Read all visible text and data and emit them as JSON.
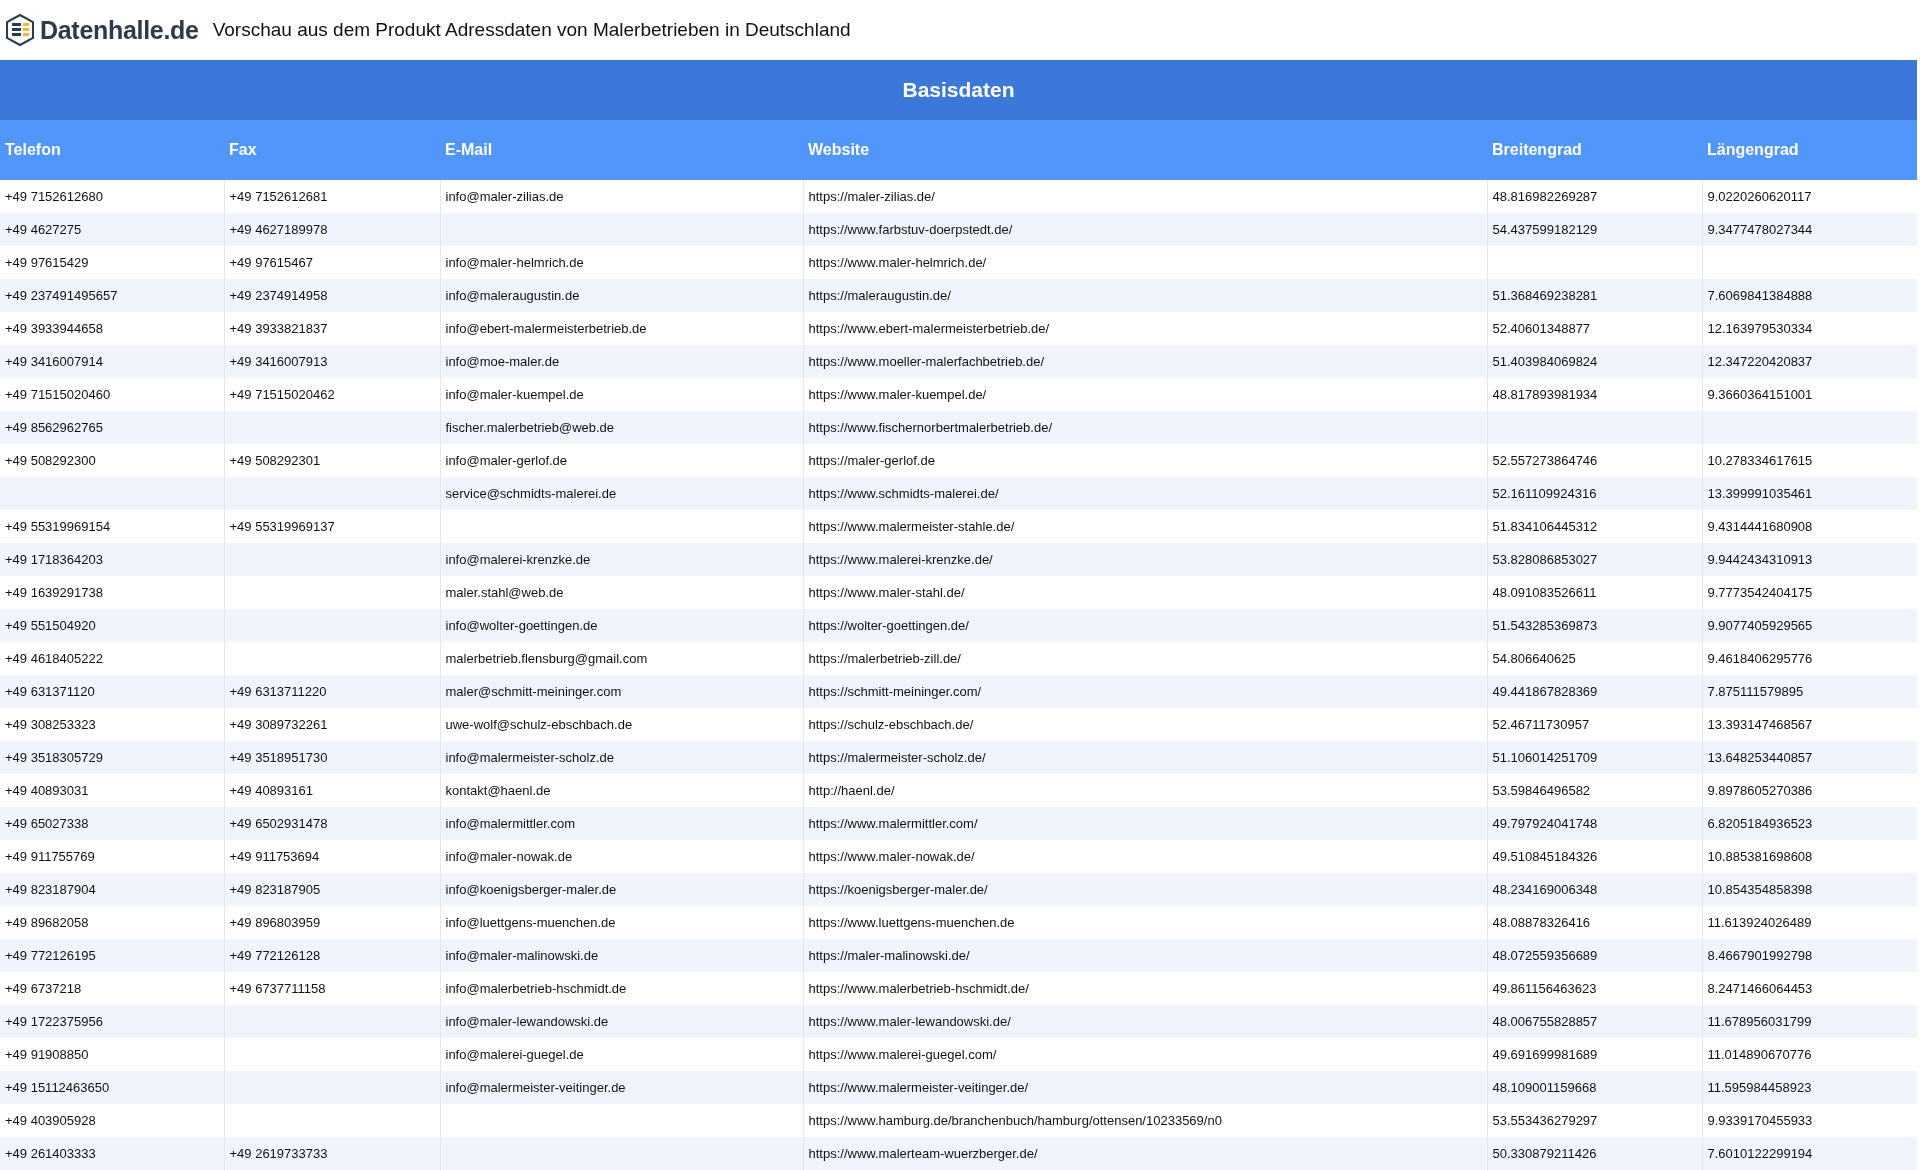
{
  "header": {
    "logo_text": "Datenhalle.de",
    "title": "Vorschau aus dem Produkt Adressdaten von Malerbetrieben in Deutschland"
  },
  "table": {
    "group_heading": "Basisdaten",
    "columns": [
      "Telefon",
      "Fax",
      "E-Mail",
      "Website",
      "Breitengrad",
      "Längengrad"
    ],
    "rows": [
      [
        "+49 7152612680",
        "+49 7152612681",
        "info@maler-zilias.de",
        "https://maler-zilias.de/",
        "48.816982269287",
        "9.0220260620117"
      ],
      [
        "+49 4627275",
        "+49 4627189978",
        null,
        "https://www.farbstuv-doerpstedt.de/",
        "54.437599182129",
        "9.3477478027344"
      ],
      [
        "+49 97615429",
        "+49 97615467",
        "info@maler-helmrich.de",
        "https://www.maler-helmrich.de/",
        null,
        null
      ],
      [
        "+49 237491495657",
        "+49 2374914958",
        "info@maleraugustin.de",
        "https://maleraugustin.de/",
        "51.368469238281",
        "7.6069841384888"
      ],
      [
        "+49 3933944658",
        "+49 3933821837",
        "info@ebert-malermeisterbetrieb.de",
        "https://www.ebert-malermeisterbetrieb.de/",
        "52.40601348877",
        "12.163979530334"
      ],
      [
        "+49 3416007914",
        "+49 3416007913",
        "info@moe-maler.de",
        "https://www.moeller-malerfachbetrieb.de/",
        "51.403984069824",
        "12.347220420837"
      ],
      [
        "+49 71515020460",
        "+49 71515020462",
        "info@maler-kuempel.de",
        "https://www.maler-kuempel.de/",
        "48.817893981934",
        "9.3660364151001"
      ],
      [
        "+49 8562962765",
        null,
        "fischer.malerbetrieb@web.de",
        "https://www.fischernorbertmalerbetrieb.de/",
        null,
        null
      ],
      [
        "+49 508292300",
        "+49 508292301",
        "info@maler-gerlof.de",
        "https://maler-gerlof.de",
        "52.557273864746",
        "10.278334617615"
      ],
      [
        null,
        null,
        "service@schmidts-malerei.de",
        "https://www.schmidts-malerei.de/",
        "52.161109924316",
        "13.399991035461"
      ],
      [
        "+49 55319969154",
        "+49 55319969137",
        null,
        "https://www.malermeister-stahle.de/",
        "51.834106445312",
        "9.4314441680908"
      ],
      [
        "+49 1718364203",
        null,
        "info@malerei-krenzke.de",
        "https://www.malerei-krenzke.de/",
        "53.828086853027",
        "9.9442434310913"
      ],
      [
        "+49 1639291738",
        null,
        "maler.stahl@web.de",
        "https://www.maler-stahl.de/",
        "48.091083526611",
        "9.7773542404175"
      ],
      [
        "+49 551504920",
        null,
        "info@wolter-goettingen.de",
        "https://wolter-goettingen.de/",
        "51.543285369873",
        "9.9077405929565"
      ],
      [
        "+49 4618405222",
        null,
        "malerbetrieb.flensburg@gmail.com",
        "https://malerbetrieb-zill.de/",
        "54.806640625",
        "9.4618406295776"
      ],
      [
        "+49 631371120",
        "+49 6313711220",
        "maler@schmitt-meininger.com",
        "https://schmitt-meininger.com/",
        "49.441867828369",
        "7.875111579895"
      ],
      [
        "+49 308253323",
        "+49 3089732261",
        "uwe-wolf@schulz-ebschbach.de",
        "https://schulz-ebschbach.de/",
        "52.46711730957",
        "13.393147468567"
      ],
      [
        "+49 3518305729",
        "+49 3518951730",
        "info@malermeister-scholz.de",
        "https://malermeister-scholz.de/",
        "51.106014251709",
        "13.648253440857"
      ],
      [
        "+49 40893031",
        "+49 40893161",
        "kontakt@haenl.de",
        "http://haenl.de/",
        "53.59846496582",
        "9.8978605270386"
      ],
      [
        "+49 65027338",
        "+49 6502931478",
        "info@malermittler.com",
        "https://www.malermittler.com/",
        "49.797924041748",
        "6.8205184936523"
      ],
      [
        "+49 911755769",
        "+49 911753694",
        "info@maler-nowak.de",
        "https://www.maler-nowak.de/",
        "49.510845184326",
        "10.885381698608"
      ],
      [
        "+49 823187904",
        "+49 823187905",
        "info@koenigsberger-maler.de",
        "https://koenigsberger-maler.de/",
        "48.234169006348",
        "10.854354858398"
      ],
      [
        "+49 89682058",
        "+49 896803959",
        "info@luettgens-muenchen.de",
        "https://www.luettgens-muenchen.de",
        "48.08878326416",
        "11.613924026489"
      ],
      [
        "+49 772126195",
        "+49 772126128",
        "info@maler-malinowski.de",
        "https://maler-malinowski.de/",
        "48.072559356689",
        "8.4667901992798"
      ],
      [
        "+49 6737218",
        "+49 6737711158",
        "info@malerbetrieb-hschmidt.de",
        "https://www.malerbetrieb-hschmidt.de/",
        "49.861156463623",
        "8.2471466064453"
      ],
      [
        "+49 1722375956",
        null,
        "info@maler-lewandowski.de",
        "https://www.maler-lewandowski.de/",
        "48.006755828857",
        "11.678956031799"
      ],
      [
        "+49 91908850",
        null,
        "info@malerei-guegel.de",
        "https://www.malerei-guegel.com/",
        "49.691699981689",
        "11.014890670776"
      ],
      [
        "+49 15112463650",
        null,
        "info@malermeister-veitinger.de",
        "https://www.malermeister-veitinger.de/",
        "48.109001159668",
        "11.595984458923"
      ],
      [
        "+49 403905928",
        null,
        null,
        "https://www.hamburg.de/branchenbuch/hamburg/ottensen/10233569/n0",
        "53.553436279297",
        "9.9339170455933"
      ],
      [
        "+49 261403333",
        "+49 2619733733",
        null,
        "https://www.malerteam-wuerzberger.de/",
        "50.330879211426",
        "7.6010122299194"
      ]
    ]
  }
}
